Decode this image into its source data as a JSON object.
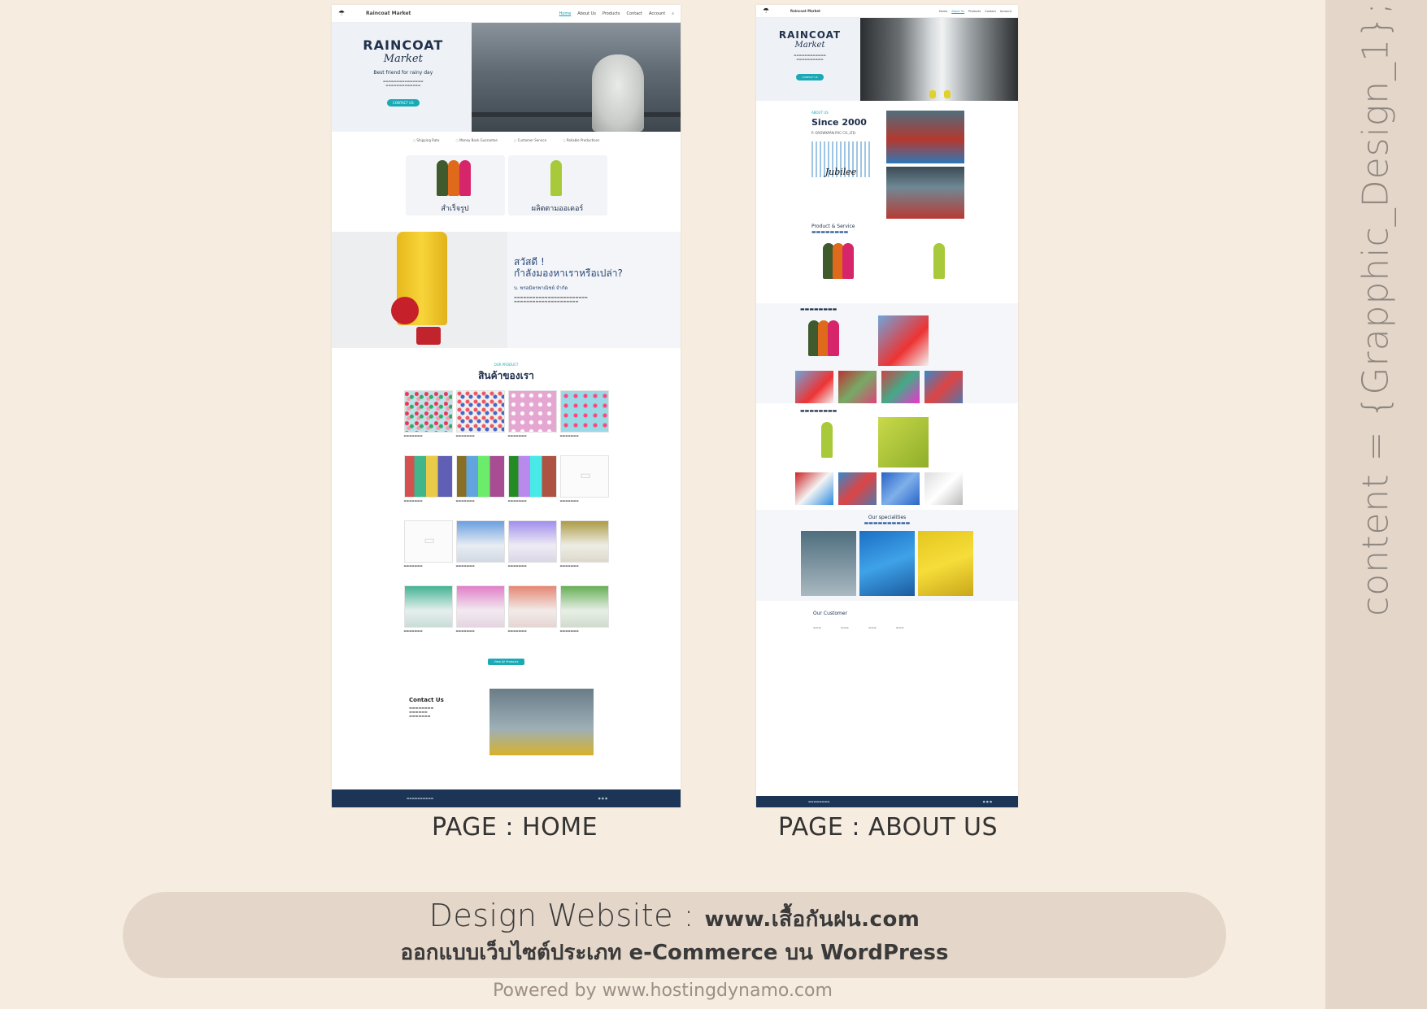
{
  "side_label": "content = {Grapphic_Design_1};",
  "home": {
    "caption": "PAGE : HOME",
    "header": {
      "logo": "☂",
      "brand": "Raincoat Market",
      "nav": [
        "Home",
        "About Us",
        "Products",
        "Contact",
        "Account"
      ]
    },
    "hero": {
      "title": "RAINCOAT",
      "script": "Market",
      "tagline": "Best friend for rainy day",
      "button": "CONTACT US"
    },
    "features": [
      "Shipping Rate",
      "Money Back Guarantee",
      "Customer Service",
      "Reliable Productions"
    ],
    "categories": [
      "สำเร็จรูป",
      "ผลิตตามออเดอร์"
    ],
    "hello": {
      "line1": "สวัสดี !",
      "line2": "กำลังมองหาเราหรือเปล่า?",
      "sub": "บ. พรอมิตรพาณิชย์ จำกัด"
    },
    "products": {
      "eyebrow": "OUR PRODUCT",
      "title": "สินค้าของเรา",
      "view_all": "View All Products"
    },
    "contact": {
      "title": "Contact Us"
    }
  },
  "about": {
    "caption": "PAGE : ABOUT US",
    "hero": {
      "title": "RAINCOAT",
      "script": "Market",
      "button": "CONTACT US"
    },
    "since": {
      "eyebrow": "ABOUT US",
      "title": "Since 2000",
      "company": "P. GROWKPAN PVC CO.,LTD.",
      "logo": "Jubilee"
    },
    "ps": {
      "title": "Product & Service"
    },
    "specialities": {
      "title": "Our specialities"
    },
    "customers": {
      "title": "Our Customer"
    }
  },
  "banner": {
    "line1_light": "Design Website : ",
    "line1_bold": "www.เสื้อกันฝน.com",
    "line2": "ออกแบบเว็บไซต์ประเภท e-Commerce บน WordPress"
  },
  "powered": "Powered by www.hostingdynamo.com",
  "colors": {
    "background": "#f6ece0",
    "accent": "#1aa9b5",
    "navy": "#1c3556",
    "banner": "#e4d6c8"
  }
}
